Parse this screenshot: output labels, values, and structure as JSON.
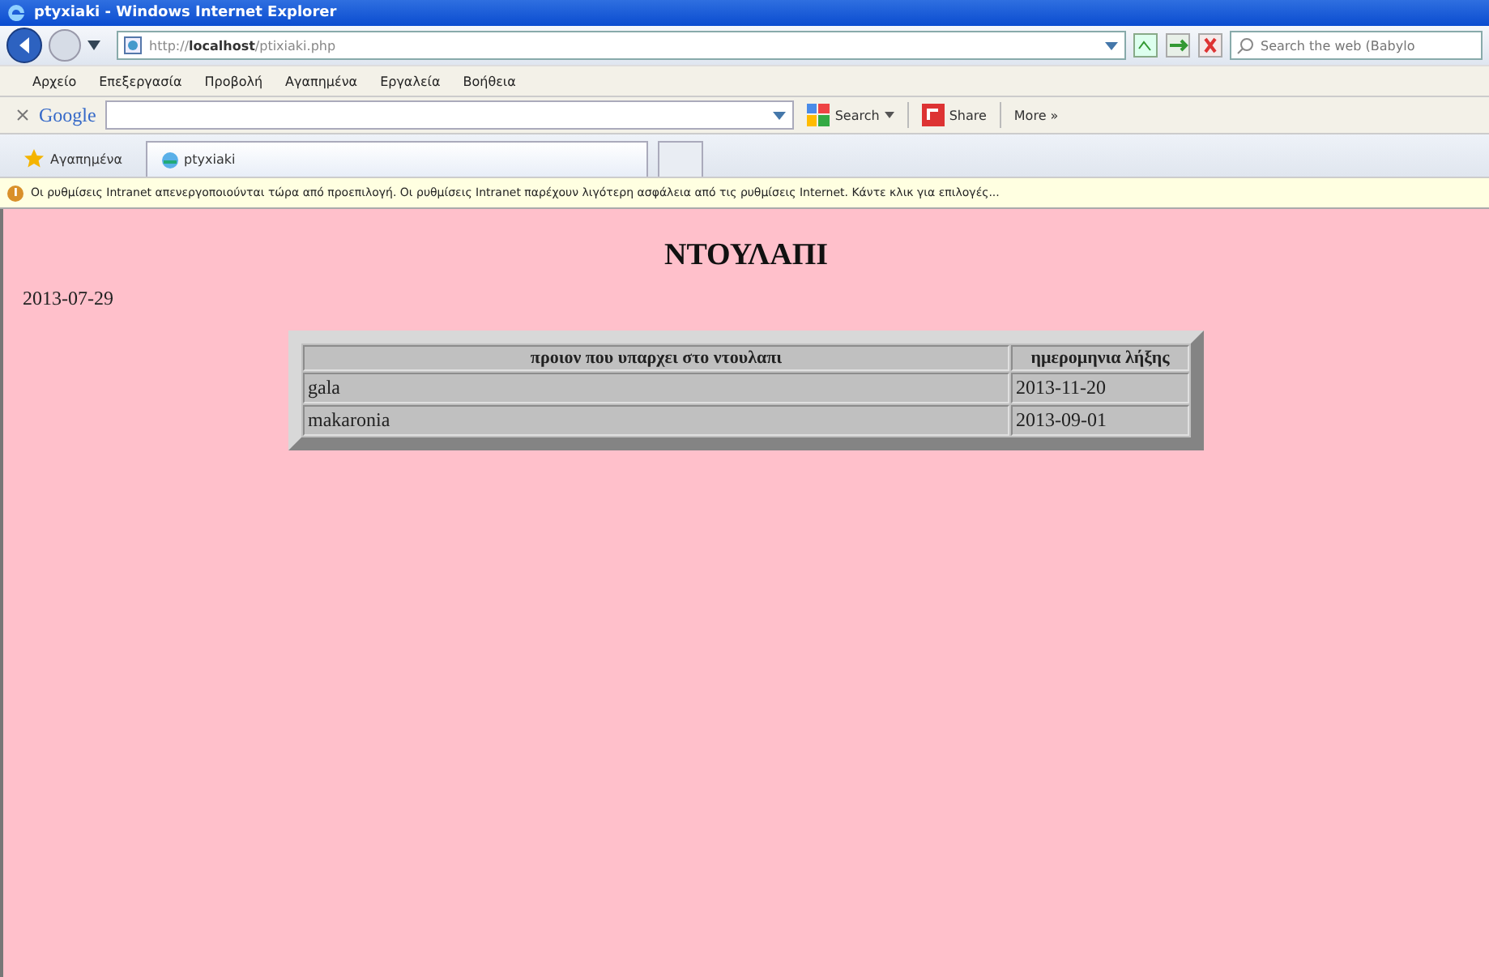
{
  "window": {
    "title": "ptyxiaki - Windows Internet Explorer"
  },
  "address_bar": {
    "url_prefix": "http://",
    "url_host": "localhost",
    "url_path": "/ptixiaki.php"
  },
  "search": {
    "placeholder": "Search the web (Babylo"
  },
  "menu": [
    "Αρχείο",
    "Επεξεργασία",
    "Προβολή",
    "Αγαπημένα",
    "Εργαλεία",
    "Βοήθεια"
  ],
  "google_toolbar": {
    "logo": "Google",
    "search_label": "Search",
    "share_label": "Share",
    "more_label": "More »"
  },
  "favorites": {
    "label": "Αγαπημένα"
  },
  "tabs": [
    {
      "label": "ptyxiaki",
      "selected": true
    }
  ],
  "infobar": {
    "text": "Οι ρυθμίσεις Intranet απενεργοποιούνται τώρα από προεπιλογή. Οι ρυθμίσεις Intranet παρέχουν λιγότερη ασφάλεια από τις ρυθμίσεις Internet. Κάντε κλικ για επιλογές..."
  },
  "page": {
    "heading": "ΝΤΟΥΛΑΠΙ",
    "date": "2013-07-29",
    "table": {
      "columns": [
        "προιον που υπαρχει στο ντουλαπι",
        "ημερομηνια λήξης"
      ],
      "rows": [
        [
          "gala",
          "2013-11-20"
        ],
        [
          "makaronia",
          "2013-09-01"
        ]
      ]
    }
  }
}
